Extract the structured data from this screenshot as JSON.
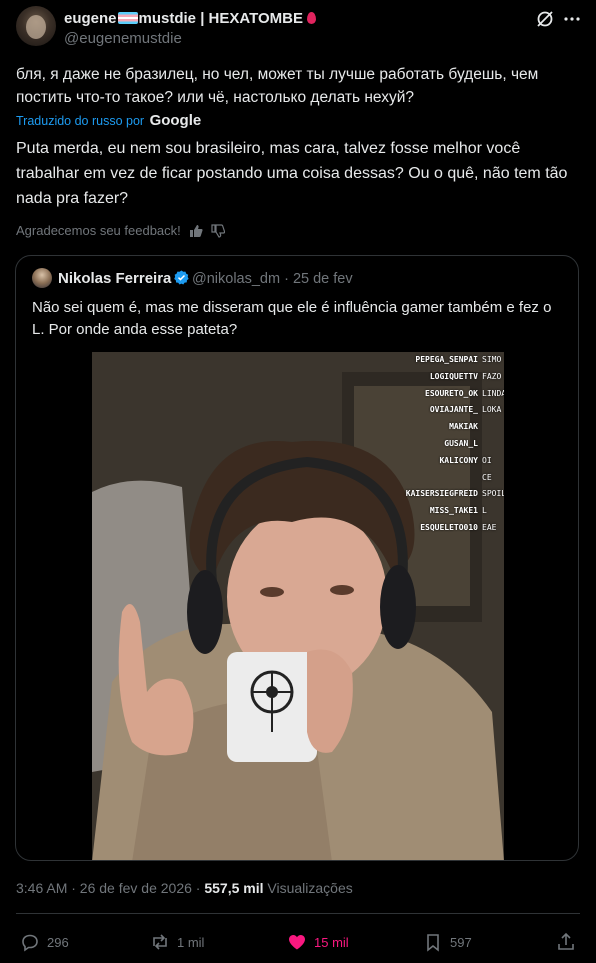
{
  "post": {
    "author_name_pre": "eugene",
    "author_name_post": "mustdie | HEXATOMBE",
    "handle": "@eugenemustdie",
    "text_original": "бля, я даже не бразилец, но чел, может ты лучше работать будешь, чем постить что-то такое? или чё, настолько делать нехуй?",
    "translated_label": "Traduzido do russo por",
    "translated_by": "Google",
    "text_translated": "Puta merda, eu nem sou brasileiro, mas cara, talvez fosse melhor você trabalhar em vez de ficar postando uma coisa dessas? Ou o quê, não tem tão nada pra fazer?",
    "feedback_label": "Agradecemos seu feedback!"
  },
  "quote": {
    "name": "Nikolas Ferreira",
    "handle_date": "@nikolas_dm · 25 de fev",
    "text": "Não sei quem é, mas me disseram que ele é influência gamer também e fez o L. Por onde anda esse pateta?",
    "chat_names": [
      "PEPEGA_SENPAI",
      "LOGIQUETTV",
      "ESOURETO_OK",
      "OVIAJANTE_",
      "MAKIAK",
      "GUSAN_L",
      "KALICONY",
      "KAISERSIEGFREID",
      "MISS_TAKE1",
      "ESQUELETO010"
    ],
    "chat_msgs": [
      "SIMO",
      "FAZO",
      "LINDA",
      "LOKA",
      "",
      "",
      "OI CE",
      "SPOIL",
      "L",
      "EAE"
    ]
  },
  "meta": {
    "time_date": "3:46 AM · 26 de fev de 2026 ·",
    "views_count": "557,5 mil",
    "views_label": "Visualizações"
  },
  "actions": {
    "replies": "296",
    "reposts": "1 mil",
    "likes": "15 mil",
    "bookmarks": "597"
  },
  "colors": {
    "accent": "#1d9bf0",
    "like": "#f91880",
    "muted": "#71767b"
  }
}
